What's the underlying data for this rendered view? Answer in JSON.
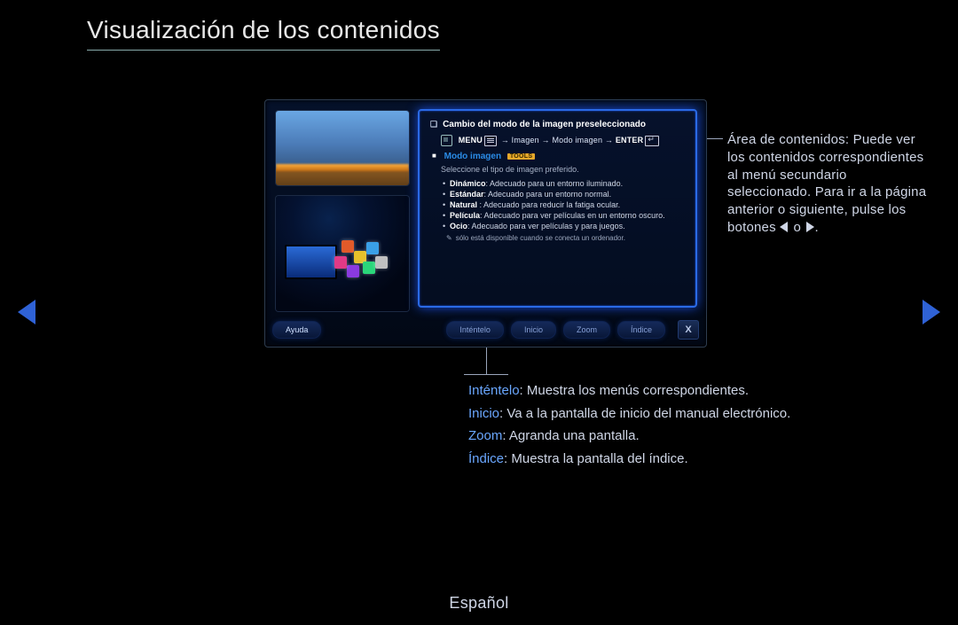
{
  "title": "Visualización de los contenidos",
  "language": "Español",
  "nav": {
    "left_icon": "triangle-left",
    "right_icon": "triangle-right"
  },
  "right_callout": {
    "heading": "Área de contenidos:",
    "body": "Puede ver los contenidos correspondientes al menú secundario seleccionado. Para ir a la página anterior o siguiente, pulse los botones",
    "or_word": "o",
    "period": "."
  },
  "bottom_callout": {
    "items": [
      {
        "kw": "Inténtelo",
        "desc": ": Muestra los menús correspondientes."
      },
      {
        "kw": "Inicio",
        "desc": ": Va a la pantalla de inicio del manual electrónico."
      },
      {
        "kw": "Zoom",
        "desc": ": Agranda una pantalla."
      },
      {
        "kw": "Índice",
        "desc": ": Muestra la pantalla del índice."
      }
    ]
  },
  "panel": {
    "header": "Cambio del modo de la imagen preseleccionado",
    "crumb_menu_label": "MENU",
    "crumb_parts": [
      "Imagen",
      "Modo imagen"
    ],
    "crumb_enter_label": "ENTER",
    "section_label": "Modo imagen",
    "tools_badge": "TOOLS",
    "subtext": "Seleccione el tipo de imagen preferido.",
    "options": [
      {
        "kw": "Dinámico",
        "desc": ": Adecuado para un entorno iluminado."
      },
      {
        "kw": "Estándar",
        "desc": ": Adecuado para un entorno normal."
      },
      {
        "kw": "Natural",
        "desc": " : Adecuado para reducir la fatiga ocular."
      },
      {
        "kw": "Película",
        "desc": ": Adecuado para ver películas en un entorno oscuro."
      },
      {
        "kw": "Ocio",
        "desc": ": Adecuado para ver películas y para juegos."
      }
    ],
    "note": "sólo está disponible cuando se conecta un ordenador."
  },
  "buttons": {
    "help": "Ayuda",
    "try": "Inténtelo",
    "home": "Inicio",
    "zoom": "Zoom",
    "index": "Índice",
    "close": "X"
  }
}
